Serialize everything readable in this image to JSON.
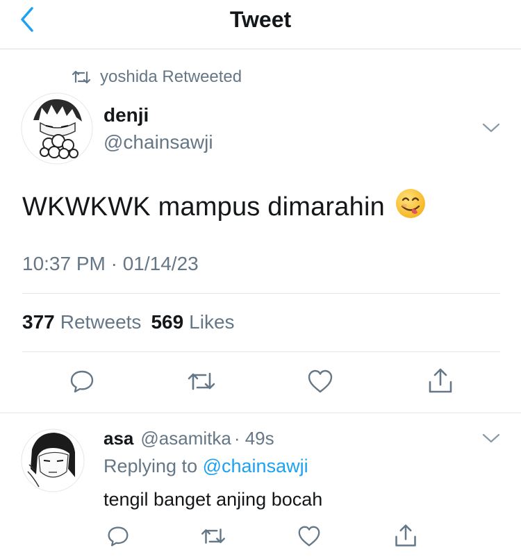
{
  "header": {
    "title": "Tweet",
    "back_icon": "chevron-left-icon",
    "accent": "#1da1f2"
  },
  "retweet": {
    "label": "yoshida Retweeted",
    "icon": "retweet-icon"
  },
  "tweet": {
    "name": "denji",
    "handle": "@chainsawji",
    "text": "WKWKWK mampus dimarahin",
    "emoji": "face-savoring-food",
    "timestamp": "10:37 PM · 01/14/23",
    "retweets_count": "377",
    "retweets_label": "Retweets",
    "likes_count": "569",
    "likes_label": "Likes",
    "actions": [
      "reply-icon",
      "retweet-icon",
      "like-icon",
      "share-icon"
    ]
  },
  "reply": {
    "name": "asa",
    "handle": "@asamitka",
    "time": "· 49s",
    "replying_prefix": "Replying to",
    "replying_to": "@chainsawji",
    "text": "tengil banget anjing bocah",
    "actions": [
      "reply-icon",
      "retweet-icon",
      "like-icon",
      "share-icon"
    ]
  },
  "colors": {
    "text": "#14171a",
    "secondary": "#657786",
    "divider": "#e1e8ed",
    "link": "#1da1f2"
  }
}
